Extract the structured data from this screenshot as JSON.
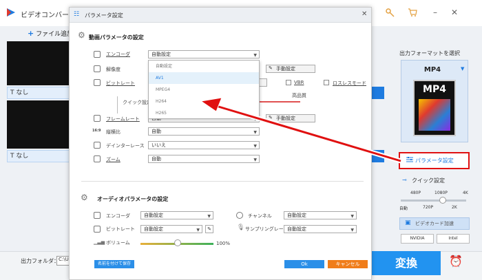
{
  "app": {
    "title": "ビデオコンバー",
    "add_file": "ファイル追加"
  },
  "left_list": {
    "items": [
      {
        "subtitle": "なし"
      },
      {
        "subtitle": "なし"
      }
    ]
  },
  "bottom": {
    "folder_label": "出力フォルダ：",
    "folder_value": "C:\\U",
    "convert": "変換"
  },
  "right_panel": {
    "format_label": "出力フォーマットを選択",
    "format_name": "MP4",
    "format_tile_text": "MP4",
    "param_button": "パラメータ設定",
    "quick_label": "クイック設定",
    "ticks_top": [
      "480P",
      "1080P",
      "4K"
    ],
    "ticks_bottom": [
      "自動",
      "720P",
      "2K"
    ],
    "gpu_label": "ビデオカード加速",
    "chips": [
      "NVIDIA",
      "Intel"
    ]
  },
  "dialog": {
    "title": "パラメータ設定",
    "video_section": "動画パラメータの設定",
    "encoder_label": "エンコーダ",
    "encoder_value": "自動設定",
    "resolution_label": "解像度",
    "manual_label": "手動設定",
    "bitrate_label": "ビットレート",
    "bitrate_btn": "定",
    "vbr": "VBR",
    "lossless": "ロスレスモード",
    "quality_high": "高品質",
    "quick_setting": "クイック設定",
    "framerate_label": "フレームレート",
    "framerate_value": "自動",
    "aspect_label": "縦横比",
    "aspect_value": "自動",
    "deinterlace_label": "デインターレース",
    "deinterlace_value": "いいえ",
    "zoom_label": "ズーム",
    "zoom_value": "自動",
    "audio_section": "オーディオパラメータの設定",
    "a_encoder_label": "エンコーダ",
    "a_encoder_value": "自動設定",
    "a_bitrate_label": "ビットレート",
    "a_bitrate_value": "自動設定",
    "a_volume_label": "ボリューム",
    "a_volume_value": "100%",
    "channel_label": "チャンネル",
    "channel_value": "自動設定",
    "sample_label": "サンプリングレート",
    "sample_value": "自動設定",
    "save_as": "名前を付けて保存",
    "ok": "Ok",
    "cancel": "キャンセル"
  },
  "encoder_dropdown": {
    "options": [
      "自動設定",
      "AV1",
      "MPEG4",
      "H264",
      "H265"
    ],
    "selected_index": 1
  },
  "colors": {
    "accent": "#1e7be0",
    "convert": "#2293f0",
    "highlight": "#e01010",
    "cancel": "#f07d1a"
  }
}
